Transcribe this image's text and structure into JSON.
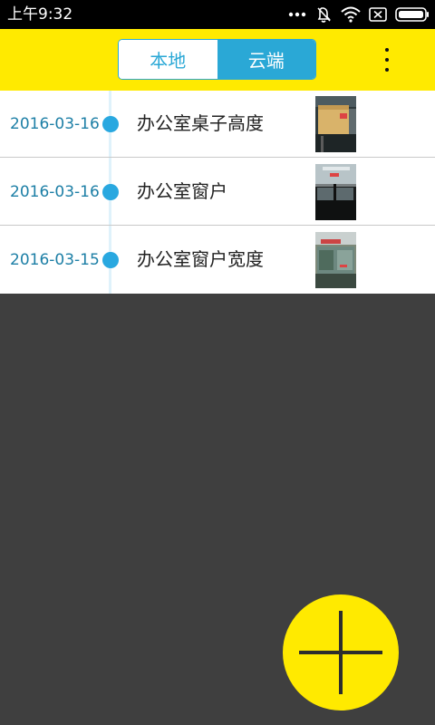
{
  "status_bar": {
    "time": "上午9:32",
    "icons": [
      "more-dots-icon",
      "vibrate-off-icon",
      "wifi-icon",
      "sim-card-icon",
      "battery-icon"
    ]
  },
  "header": {
    "tabs": [
      {
        "label": "本地",
        "selected": false
      },
      {
        "label": "云端",
        "selected": true
      }
    ],
    "menu_icon": "more-vertical-icon",
    "accent_color": "#ffea00",
    "tab_color": "#2aa8d6"
  },
  "records": [
    {
      "date": "2016-03-16",
      "title": "办公室桌子高度",
      "thumbnail": "desk-photo"
    },
    {
      "date": "2016-03-16",
      "title": "办公室窗户",
      "thumbnail": "window-photo"
    },
    {
      "date": "2016-03-15",
      "title": "办公室窗户宽度",
      "thumbnail": "window-width-photo"
    }
  ],
  "fab": {
    "icon": "plus-icon",
    "color": "#ffea00"
  }
}
